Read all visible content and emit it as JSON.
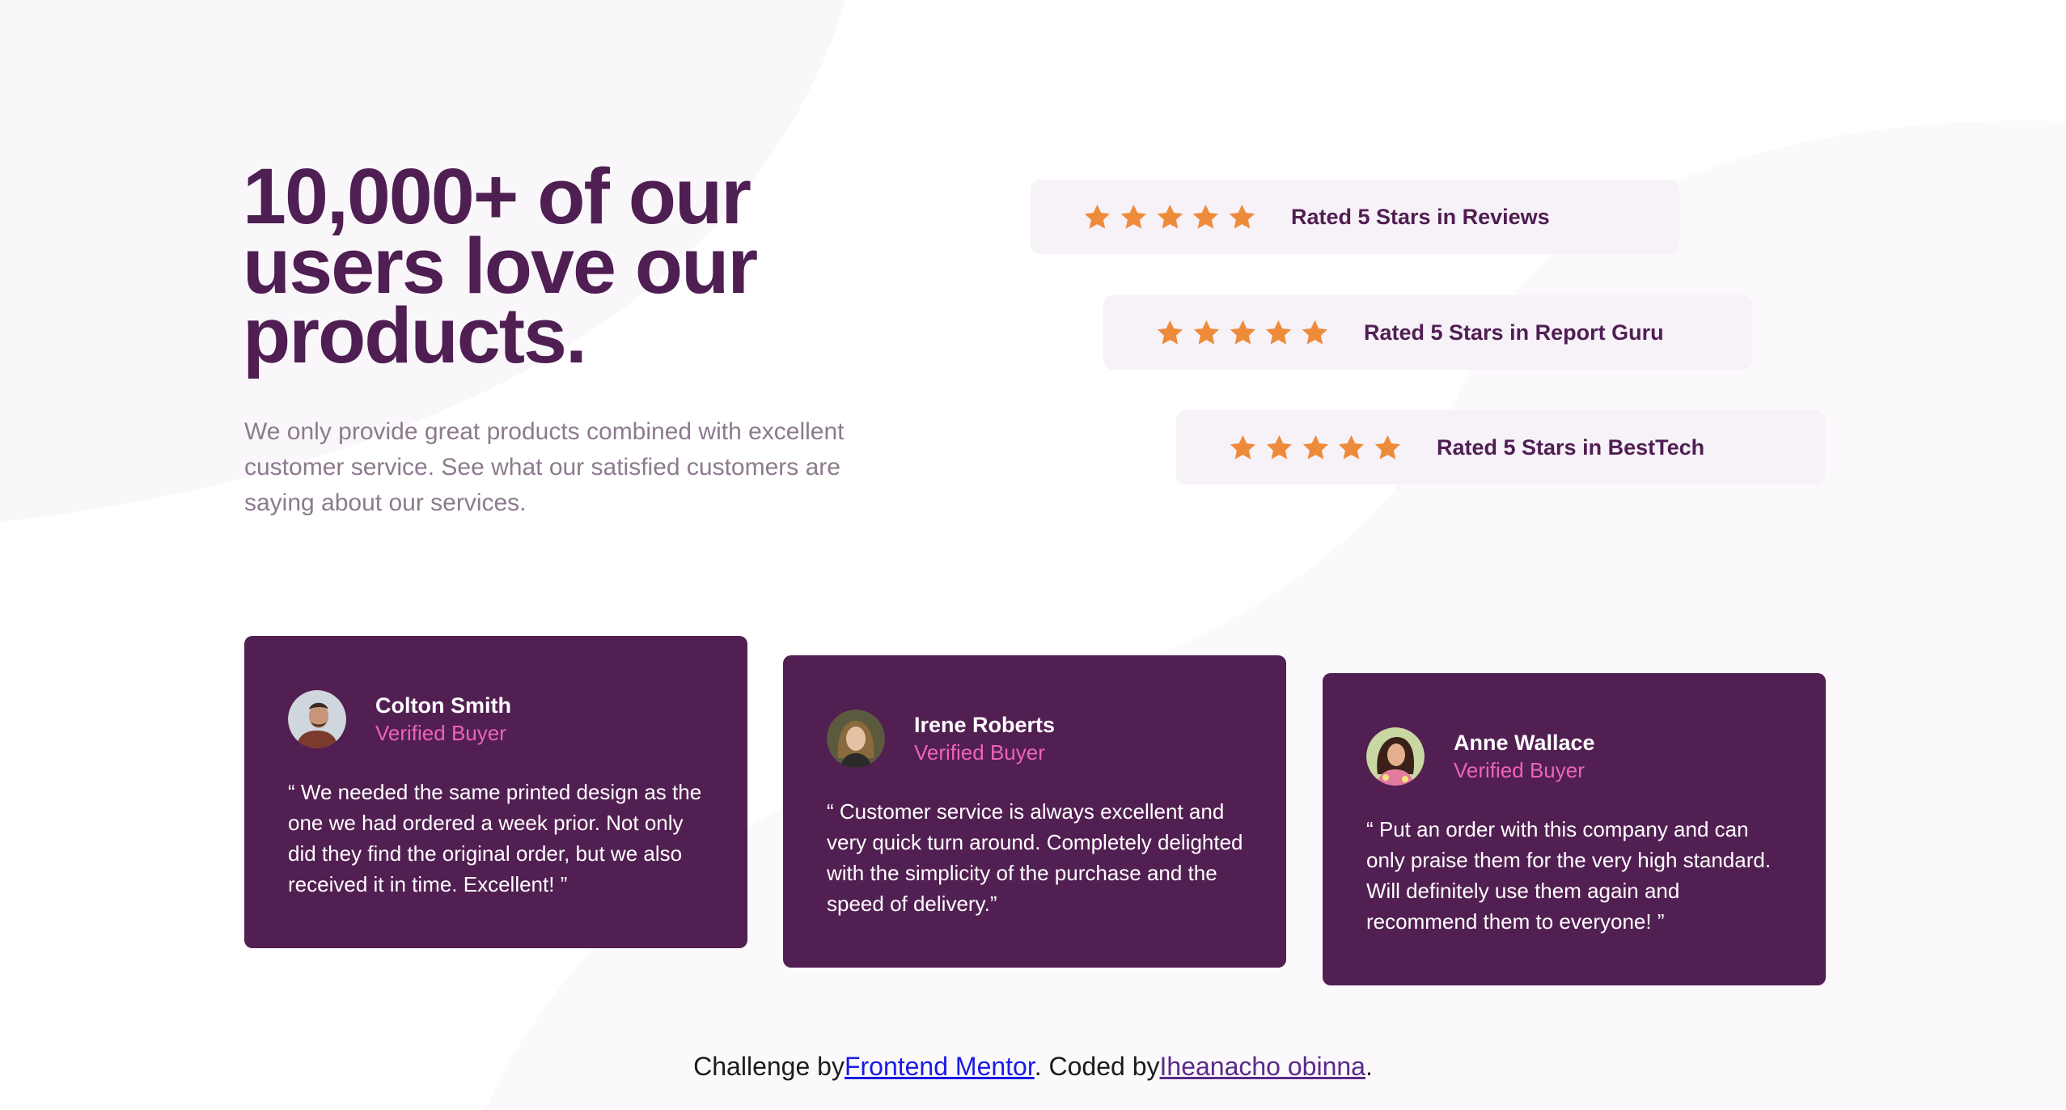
{
  "hero": {
    "title": "10,000+ of our users love our products.",
    "description": "We only provide great products combined with excellent customer service. See what our satisfied customers are saying about our services."
  },
  "ratings": [
    {
      "stars": 5,
      "label": "Rated 5 Stars in Reviews"
    },
    {
      "stars": 5,
      "label": "Rated 5 Stars in Report Guru"
    },
    {
      "stars": 5,
      "label": "Rated 5 Stars in BestTech"
    }
  ],
  "testimonials": [
    {
      "name": "Colton Smith",
      "tag": "Verified Buyer",
      "quote": "“ We needed the same printed design as the one we had ordered a week prior. Not only did they find the original order, but we also received it in time. Excellent! ”"
    },
    {
      "name": "Irene Roberts",
      "tag": "Verified Buyer",
      "quote": "“ Customer service is always excellent and very quick turn around. Completely delighted with the simplicity of the purchase and the speed of delivery.”"
    },
    {
      "name": "Anne Wallace",
      "tag": "Verified Buyer",
      "quote": "“ Put an order with this company and can only praise them for the very high standard. Will definitely use them again and recommend them to everyone! ”"
    }
  ],
  "footer": {
    "prefix": "Challenge by",
    "mentor_link": "Frontend Mentor",
    "middle": ". Coded by",
    "author_link": "Iheanacho obinna",
    "suffix": "."
  },
  "colors": {
    "primary": "#4f1e52",
    "card_bg": "#521f52",
    "rating_bg": "#f7f1f8",
    "star": "#ee8b3a",
    "accent_pink": "#ec64b6",
    "muted_text": "#8d7a8e"
  },
  "icons": {
    "star": "star-icon"
  }
}
